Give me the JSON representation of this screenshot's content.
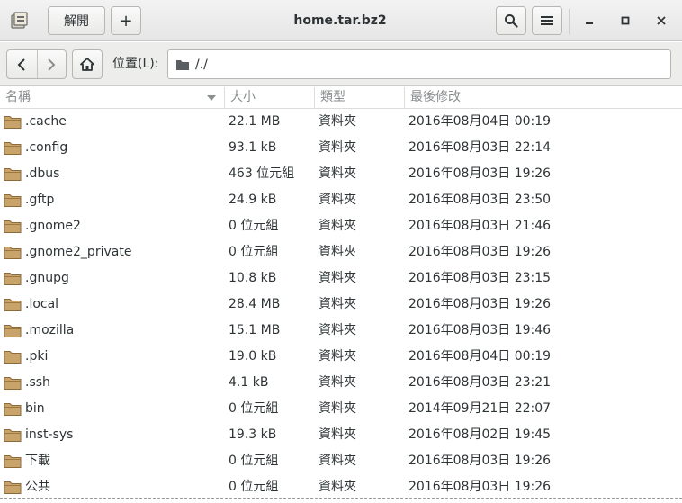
{
  "window": {
    "title": "home.tar.bz2",
    "extract_label": "解開",
    "add_label": "+",
    "icons": {
      "app": "archive-icon",
      "search": "search-icon",
      "menu": "hamburger-menu-icon",
      "minimize": "minimize-icon",
      "maximize": "maximize-icon",
      "close": "close-icon"
    }
  },
  "location": {
    "label": "位置(L):",
    "path": "/./"
  },
  "columns": {
    "name": "名稱",
    "size": "大小",
    "type": "類型",
    "modified": "最後修改"
  },
  "rows": [
    {
      "name": ".cache",
      "size": "22.1 MB",
      "type": "資料夾",
      "modified": "2016年08月04日 00:19"
    },
    {
      "name": ".config",
      "size": "93.1 kB",
      "type": "資料夾",
      "modified": "2016年08月03日 22:14"
    },
    {
      "name": ".dbus",
      "size": "463 位元組",
      "type": "資料夾",
      "modified": "2016年08月03日 19:26"
    },
    {
      "name": ".gftp",
      "size": "24.9 kB",
      "type": "資料夾",
      "modified": "2016年08月03日 23:50"
    },
    {
      "name": ".gnome2",
      "size": "0 位元組",
      "type": "資料夾",
      "modified": "2016年08月03日 21:46"
    },
    {
      "name": ".gnome2_private",
      "size": "0 位元組",
      "type": "資料夾",
      "modified": "2016年08月03日 19:26"
    },
    {
      "name": ".gnupg",
      "size": "10.8 kB",
      "type": "資料夾",
      "modified": "2016年08月03日 23:15"
    },
    {
      "name": ".local",
      "size": "28.4 MB",
      "type": "資料夾",
      "modified": "2016年08月03日 19:26"
    },
    {
      "name": ".mozilla",
      "size": "15.1 MB",
      "type": "資料夾",
      "modified": "2016年08月03日 19:46"
    },
    {
      "name": ".pki",
      "size": "19.0 kB",
      "type": "資料夾",
      "modified": "2016年08月04日 00:19"
    },
    {
      "name": ".ssh",
      "size": "4.1 kB",
      "type": "資料夾",
      "modified": "2016年08月03日 23:21"
    },
    {
      "name": "bin",
      "size": "0 位元組",
      "type": "資料夾",
      "modified": "2014年09月21日 22:07"
    },
    {
      "name": "inst-sys",
      "size": "19.3 kB",
      "type": "資料夾",
      "modified": "2016年08月02日 19:45"
    },
    {
      "name": "下載",
      "size": "0 位元組",
      "type": "資料夾",
      "modified": "2016年08月03日 19:26"
    },
    {
      "name": "公共",
      "size": "0 位元組",
      "type": "資料夾",
      "modified": "2016年08月03日 19:26"
    }
  ],
  "colors": {
    "folder": "#c9a46a",
    "folder_dark": "#8d6a3a",
    "header_text": "#8a8e8f"
  }
}
